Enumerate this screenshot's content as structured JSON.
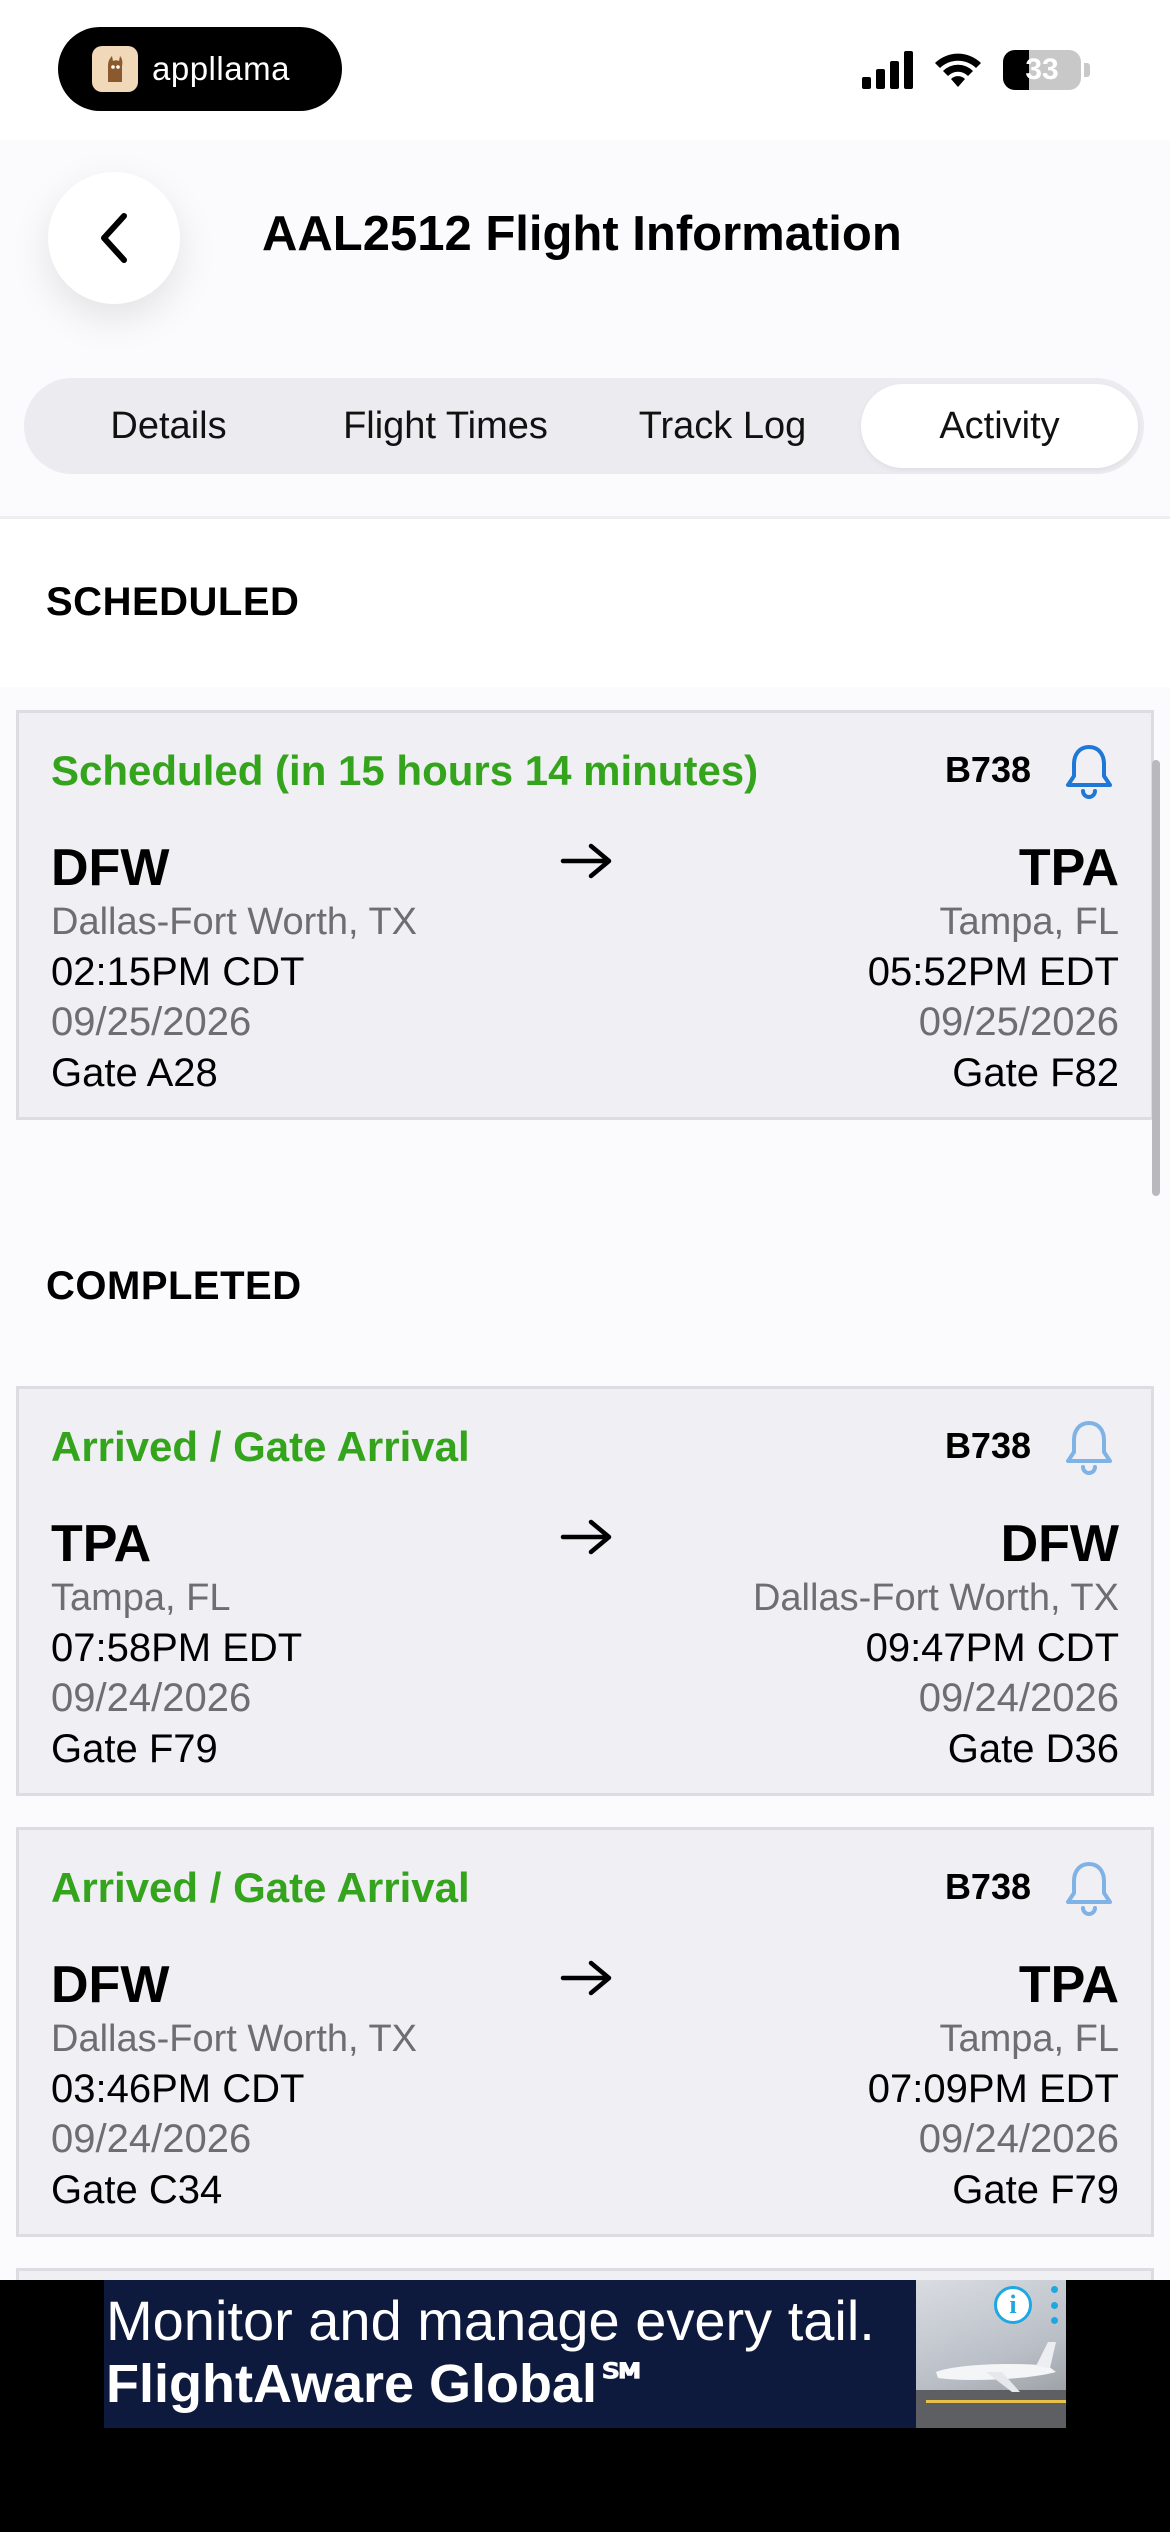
{
  "status_bar": {
    "app_badge_text": "appllama",
    "battery_level": "33"
  },
  "header": {
    "title": "AAL2512 Flight Information"
  },
  "tabs": [
    {
      "label": "Details",
      "active": false
    },
    {
      "label": "Flight Times",
      "active": false
    },
    {
      "label": "Track Log",
      "active": false
    },
    {
      "label": "Activity",
      "active": true
    }
  ],
  "sections": {
    "scheduled_title": "SCHEDULED",
    "completed_title": "COMPLETED"
  },
  "flights": [
    {
      "status": "Scheduled (in 15 hours 14 minutes)",
      "aircraft": "B738",
      "origin": {
        "code": "DFW",
        "city": "Dallas-Fort Worth, TX",
        "time": "02:15PM CDT",
        "date": "09/25/2026",
        "gate": "Gate A28"
      },
      "destination": {
        "code": "TPA",
        "city": "Tampa, FL",
        "time": "05:52PM EDT",
        "date": "09/25/2026",
        "gate": "Gate F82"
      }
    },
    {
      "status": "Arrived / Gate Arrival",
      "aircraft": "B738",
      "origin": {
        "code": "TPA",
        "city": "Tampa, FL",
        "time": "07:58PM EDT",
        "date": "09/24/2026",
        "gate": "Gate F79"
      },
      "destination": {
        "code": "DFW",
        "city": "Dallas-Fort Worth, TX",
        "time": "09:47PM CDT",
        "date": "09/24/2026",
        "gate": "Gate D36"
      }
    },
    {
      "status": "Arrived / Gate Arrival",
      "aircraft": "B738",
      "origin": {
        "code": "DFW",
        "city": "Dallas-Fort Worth, TX",
        "time": "03:46PM CDT",
        "date": "09/24/2026",
        "gate": "Gate C34"
      },
      "destination": {
        "code": "TPA",
        "city": "Tampa, FL",
        "time": "07:09PM EDT",
        "date": "09/24/2026",
        "gate": "Gate F79"
      }
    }
  ],
  "ad": {
    "line1": "Monitor and manage every tail.",
    "line2": "FlightAware Global℠"
  },
  "colors": {
    "status_green": "#35a41d",
    "bell_active": "#1f78d6",
    "bell_muted": "#7fb2e5",
    "card_background": "#efeff4"
  },
  "icons": [
    "llama-logo-icon",
    "cellular-signal-icon",
    "wifi-icon",
    "battery-icon",
    "chevron-left-icon",
    "bell-icon",
    "arrow-right-icon",
    "info-icon",
    "kebab-menu-icon"
  ]
}
